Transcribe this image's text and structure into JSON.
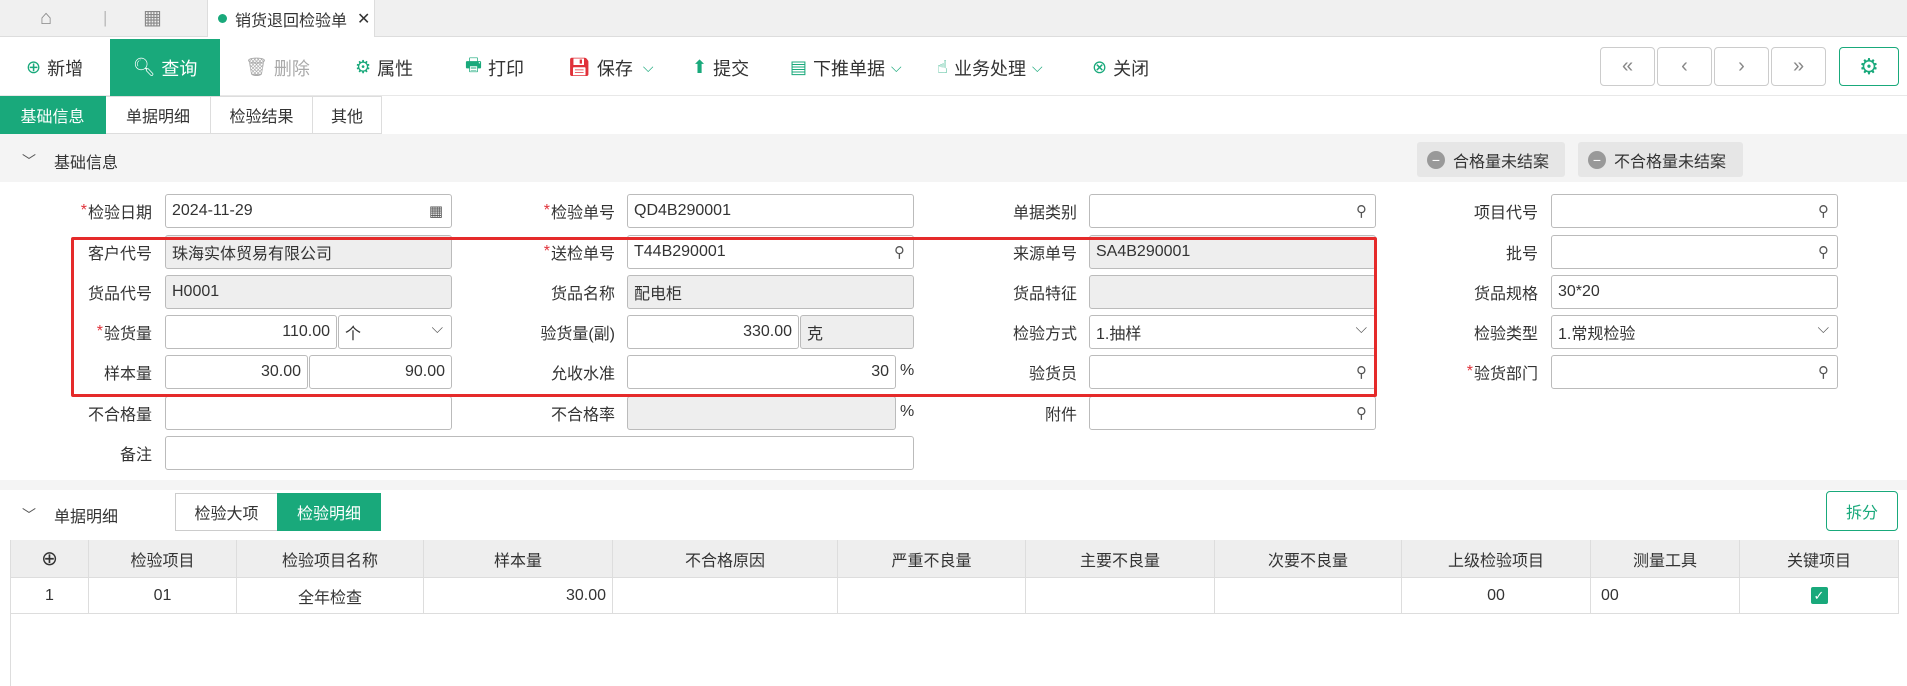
{
  "topbar": {
    "home_icon": "home-icon",
    "apps_icon": "grid-icon",
    "active_tab": "销货退回检验单"
  },
  "toolbar": {
    "new": "新增",
    "query": "查询",
    "delete": "删除",
    "properties": "属性",
    "print": "打印",
    "save": "保存",
    "submit": "提交",
    "push_down": "下推单据",
    "business": "业务处理",
    "close": "关闭"
  },
  "nav": {
    "first": "«",
    "prev": "‹",
    "next": "›",
    "last": "»"
  },
  "tabs": [
    "基础信息",
    "单据明细",
    "检验结果",
    "其他"
  ],
  "section1": {
    "title": "基础信息",
    "pill1": "合格量未结案",
    "pill2": "不合格量未结案"
  },
  "form": {
    "inspect_date_label": "检验日期",
    "inspect_date": "2024-11-29",
    "inspect_no_label": "检验单号",
    "inspect_no": "QD4B290001",
    "doc_type_label": "单据类别",
    "doc_type": "",
    "project_code_label": "项目代号",
    "project_code": "",
    "customer_label": "客户代号",
    "customer": "珠海实体贸易有限公司",
    "send_no_label": "送检单号",
    "send_no": "T44B290001",
    "source_no_label": "来源单号",
    "source_no": "SA4B290001",
    "batch_label": "批号",
    "batch": "",
    "item_code_label": "货品代号",
    "item_code": "H0001",
    "item_name_label": "货品名称",
    "item_name": "配电柜",
    "item_feature_label": "货品特征",
    "item_feature": "",
    "item_spec_label": "货品规格",
    "item_spec": "30*20",
    "qty_label": "验货量",
    "qty": "110.00",
    "qty_unit": "个",
    "qty2_label": "验货量(副)",
    "qty2": "330.00",
    "qty2_unit": "克",
    "method_label": "检验方式",
    "method": "1.抽样",
    "type_label": "检验类型",
    "type": "1.常规检验",
    "sample_label": "样本量",
    "sample1": "30.00",
    "sample2": "90.00",
    "accept_label": "允收水准",
    "accept": "30",
    "pct": "%",
    "inspector_label": "验货员",
    "inspector": "",
    "dept_label": "验货部门",
    "dept": "",
    "reject_qty_label": "不合格量",
    "reject_qty": "",
    "reject_rate_label": "不合格率",
    "reject_rate": "",
    "attach_label": "附件",
    "attach": "",
    "remark_label": "备注",
    "remark": ""
  },
  "section2": {
    "title": "单据明细",
    "subtab1": "检验大项",
    "subtab2": "检验明细",
    "split": "拆分"
  },
  "grid": {
    "headers": [
      "",
      "检验项目",
      "检验项目名称",
      "样本量",
      "不合格原因",
      "严重不良量",
      "主要不良量",
      "次要不良量",
      "上级检验项目",
      "测量工具",
      "关键项目"
    ],
    "rows": [
      [
        "1",
        "01",
        "全年检查",
        "30.00",
        "",
        "",
        "",
        "",
        "00",
        "00",
        ""
      ]
    ]
  }
}
